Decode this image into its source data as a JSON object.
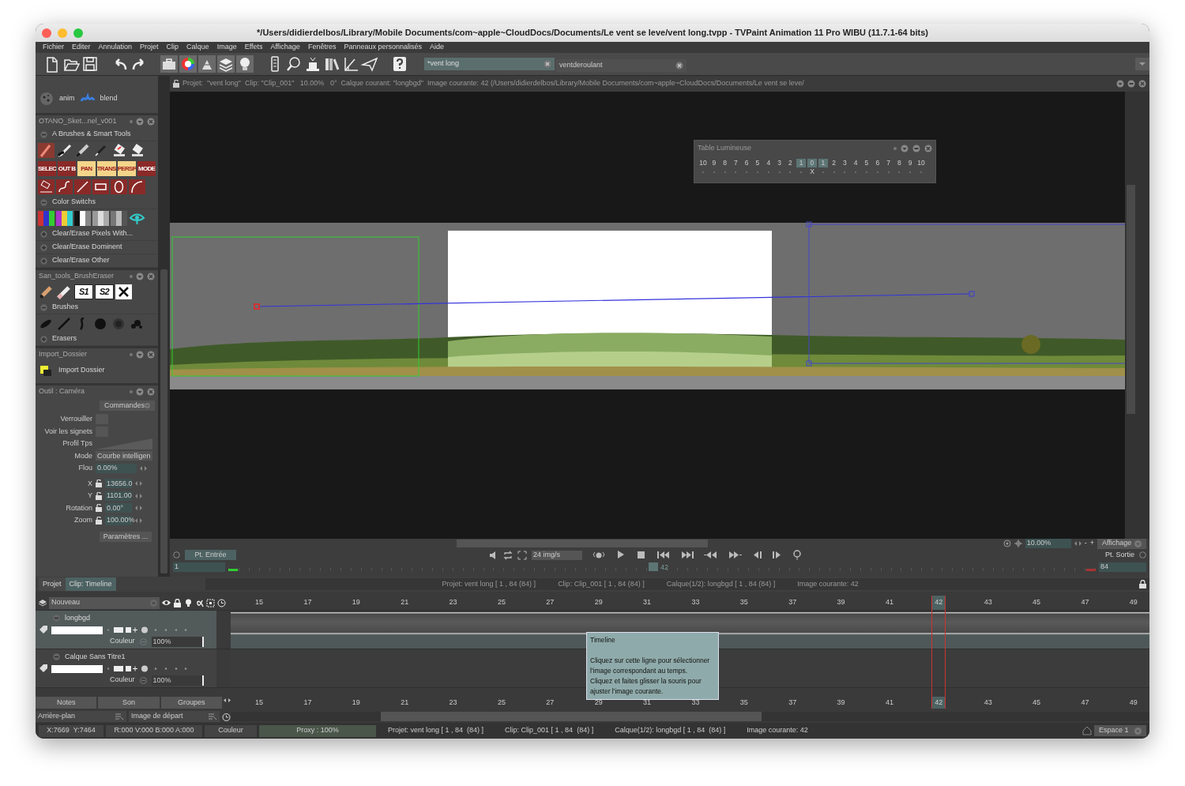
{
  "window": {
    "title": "*/Users/didierdelbos/Library/Mobile Documents/com~apple~CloudDocs/Documents/Le vent se leve/vent long.tvpp - TVPaint Animation 11 Pro WIBU (11.7.1-64 bits)"
  },
  "menu": [
    "Fichier",
    "Editer",
    "Annulation",
    "Projet",
    "Clip",
    "Calque",
    "Image",
    "Effets",
    "Affichage",
    "Fenêtres",
    "Panneaux personnalisés",
    "Aide"
  ],
  "project_tabs": [
    {
      "label": "*vent long",
      "selected": true
    },
    {
      "label": "ventderoulant",
      "selected": false
    }
  ],
  "top_row": [
    "anim",
    "blend"
  ],
  "brush_panel": {
    "title": "OTANO_Sket...nel_v001",
    "tool_labels": [
      "SELEC",
      "OUT B",
      "PAN",
      "TRANS",
      "PERSP",
      "MODE"
    ],
    "sections": [
      {
        "label": "A Brushes & Smart Tools",
        "expanded": true
      },
      {
        "label": "Color Switchs",
        "expanded": true
      },
      {
        "label": "Clear/Erase Pixels With...",
        "expanded": false
      },
      {
        "label": "Clear/Erase Dominent",
        "expanded": false
      },
      {
        "label": "Clear/Erase Other",
        "expanded": false
      }
    ]
  },
  "eraser_panel": {
    "title": "San_tools_BrushEraser",
    "stamp_labels": [
      "S1",
      "S2"
    ],
    "sections": [
      {
        "label": "Brushes",
        "expanded": true
      },
      {
        "label": "Erasers",
        "expanded": false
      }
    ]
  },
  "import_panel": {
    "title": "Import_Dossier",
    "item": "Import Dossier"
  },
  "camera_panel": {
    "title": "Outil : Caméra",
    "commands": "Commandes",
    "rows": [
      {
        "label": "Verrouiller",
        "kind": "checkbox",
        "checked": false
      },
      {
        "label": "Voir les signets",
        "kind": "checkbox",
        "checked": false
      },
      {
        "label": "Profil Tps",
        "kind": "curve"
      },
      {
        "label": "Mode",
        "kind": "select",
        "value": "Courbe intelligen"
      },
      {
        "label": "Flou",
        "kind": "field",
        "value": "0.00%"
      },
      {
        "label": "X",
        "kind": "locked",
        "value": "13656.0"
      },
      {
        "label": "Y",
        "kind": "locked",
        "value": "1101.00"
      },
      {
        "label": "Rotation",
        "kind": "locked",
        "value": "0.00°"
      },
      {
        "label": "Zoom",
        "kind": "locked",
        "value": "100.00%"
      }
    ],
    "button": "Paramètres ..."
  },
  "viewport": {
    "info": "Projet:  \"vent long\"  Clip: \"Clip_001\"   10.00%   0°  Calque courant: \"longbgd\"  Image courante: 42 (/Users/didierdelbos/Library/Mobile Documents/com~apple~CloudDocs/Documents/Le vent se leve/",
    "light_table": {
      "title": "Table Lumineuse",
      "marker": "X",
      "cells": [
        {
          "label": "10",
          "selected": false
        },
        {
          "label": "9",
          "selected": false
        },
        {
          "label": "8",
          "selected": false
        },
        {
          "label": "7",
          "selected": false
        },
        {
          "label": "6",
          "selected": false
        },
        {
          "label": "5",
          "selected": false
        },
        {
          "label": "4",
          "selected": false
        },
        {
          "label": "3",
          "selected": false
        },
        {
          "label": "2",
          "selected": false
        },
        {
          "label": "1",
          "selected": true
        },
        {
          "label": "0",
          "selected": true
        },
        {
          "label": "1",
          "selected": true
        },
        {
          "label": "2",
          "selected": false
        },
        {
          "label": "3",
          "selected": false
        },
        {
          "label": "4",
          "selected": false
        },
        {
          "label": "5",
          "selected": false
        },
        {
          "label": "6",
          "selected": false
        },
        {
          "label": "7",
          "selected": false
        },
        {
          "label": "8",
          "selected": false
        },
        {
          "label": "9",
          "selected": false
        },
        {
          "label": "10",
          "selected": false
        }
      ]
    }
  },
  "playback": {
    "in_label": "Pt. Entrée",
    "fps": "24 img/s",
    "zoom": "10.00%",
    "zoom_minus": "-",
    "zoom_plus": "+",
    "view": "Affichage",
    "out_label": "Pt. Sortie",
    "start": "1",
    "current": "42",
    "end": "84",
    "level": 0.49
  },
  "timeline": {
    "tabs": [
      {
        "label": "Projet",
        "selected": false
      },
      {
        "label": "Clip: Timeline",
        "selected": true
      }
    ],
    "info": [
      "Projet: vent long [ 1 , 84  (84) ]",
      "Clip: Clip_001 [ 1 , 84  (84) ]",
      "Calque(1/2): longbgd [ 1 , 84  (84) ]",
      "Image courante: 42"
    ],
    "new_layer": "Nouveau",
    "layers": [
      {
        "name": "longbgd",
        "blend": "Couleur",
        "opacity": "100%",
        "selected": true,
        "expanded": true
      },
      {
        "name": "Calque Sans Titre1",
        "blend": "Couleur",
        "opacity": "100%",
        "selected": false,
        "expanded": true
      }
    ],
    "frames": [
      {
        "label": "15",
        "selected": false
      },
      {
        "label": "17",
        "selected": false
      },
      {
        "label": "19",
        "selected": false
      },
      {
        "label": "21",
        "selected": false
      },
      {
        "label": "23",
        "selected": false
      },
      {
        "label": "25",
        "selected": false
      },
      {
        "label": "27",
        "selected": false
      },
      {
        "label": "29",
        "selected": false
      },
      {
        "label": "31",
        "selected": false
      },
      {
        "label": "33",
        "selected": false
      },
      {
        "label": "35",
        "selected": false
      },
      {
        "label": "37",
        "selected": false
      },
      {
        "label": "39",
        "selected": false
      },
      {
        "label": "41",
        "selected": false
      },
      {
        "label": "42",
        "selected": true
      },
      {
        "label": "43",
        "selected": false
      },
      {
        "label": "45",
        "selected": false
      },
      {
        "label": "47",
        "selected": false
      },
      {
        "label": "49",
        "selected": false
      }
    ],
    "bottom_frames": [
      {
        "label": "15",
        "selected": false
      },
      {
        "label": "17",
        "selected": false
      },
      {
        "label": "19",
        "selected": false
      },
      {
        "label": "21",
        "selected": false
      },
      {
        "label": "23",
        "selected": false
      },
      {
        "label": "25",
        "selected": false
      },
      {
        "label": "27",
        "selected": false
      },
      {
        "label": "29",
        "selected": false
      },
      {
        "label": "31",
        "selected": false
      },
      {
        "label": "33",
        "selected": false
      },
      {
        "label": "35",
        "selected": false
      },
      {
        "label": "37",
        "selected": false
      },
      {
        "label": "39",
        "selected": false
      },
      {
        "label": "41",
        "selected": false
      },
      {
        "label": "42",
        "selected": true
      },
      {
        "label": "43",
        "selected": false
      },
      {
        "label": "45",
        "selected": false
      },
      {
        "label": "47",
        "selected": false
      },
      {
        "label": "49",
        "selected": false
      }
    ],
    "buttons": [
      "Notes",
      "Son",
      "Groupes"
    ],
    "background": "Arrière-plan",
    "start_image": "Image de départ",
    "tooltip": {
      "title": "Timeline",
      "lines": [
        "Cliquez sur cette ligne pour sélectionner",
        "l'image correspondant au temps.",
        "Cliquez et faites glisser la souris pour",
        "ajuster l'image courante."
      ]
    }
  },
  "status_bar": {
    "coords": "X:7669  Y:7464",
    "rgba": "R:000 V:000 B:000 A:000",
    "mode": "Couleur",
    "proxy": "Proxy : 100%",
    "info": [
      "Projet: vent long [ 1 , 84  (84) ]",
      "Clip: Clip_001 [ 1 , 84  (84) ]",
      "Calque(1/2): longbgd [ 1 , 84  (84) ]",
      "Image courante: 42"
    ],
    "workspace": "Espace 1"
  }
}
